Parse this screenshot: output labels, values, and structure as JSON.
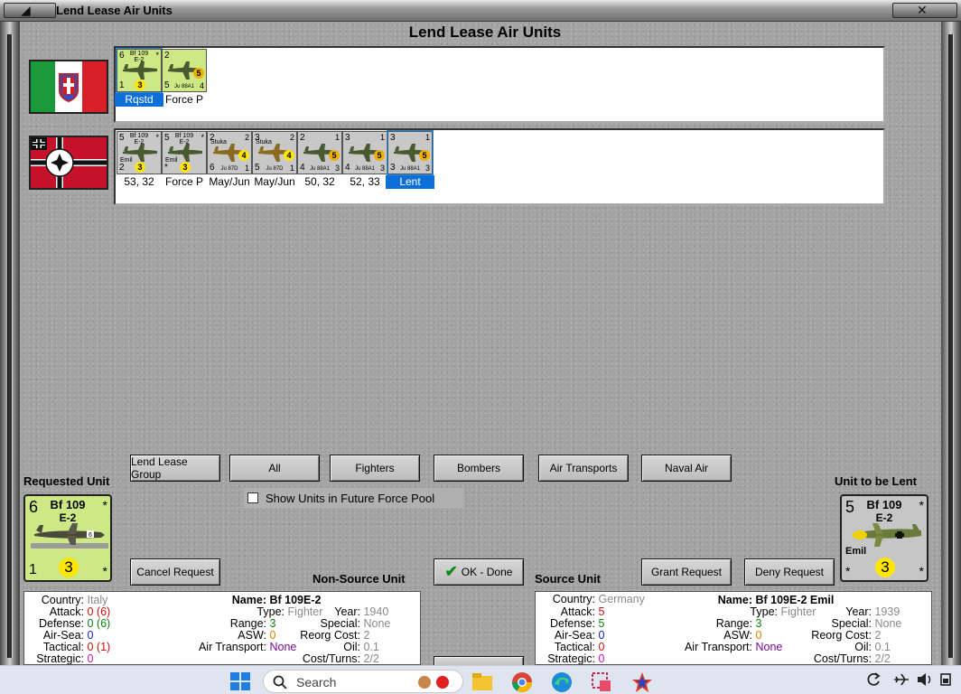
{
  "window": {
    "title": "Lend Lease Air Units"
  },
  "page_title": "Lend Lease Air Units",
  "italy_units": [
    {
      "top_left": "6",
      "name1": "Bf 109",
      "name2": "E-2",
      "star": "*",
      "bottom_left": "1",
      "value": "3",
      "label": "Rqstd",
      "selected": true,
      "bg": "#cde884"
    },
    {
      "top_left": "2",
      "name1": "",
      "name2": "",
      "star": "",
      "bottom_left": "5",
      "bottom_name": "Ju 88A1",
      "bottom_right": "4",
      "value": "5",
      "label": "Force P",
      "selected": false,
      "bg": "#cde884"
    }
  ],
  "germany_units": [
    {
      "top_left": "5",
      "name1": "Bf 109",
      "name2": "E-2",
      "sub": "Emil",
      "star": "*",
      "bottom_left": "2",
      "value": "3",
      "label": "53, 32",
      "bg": "#c8c8c8"
    },
    {
      "top_left": "5",
      "name1": "Bf 109",
      "name2": "E-2",
      "sub": "Emil",
      "star": "*",
      "bottom_left": "*",
      "value": "3",
      "label": "Force P",
      "bg": "#c8c8c8"
    },
    {
      "top_left": "2",
      "name1": "",
      "name2": "",
      "sub": "Stuka",
      "star": "2",
      "bottom_left": "6",
      "bottom_name": "Ju 87D",
      "bottom_right": "1",
      "value": "4",
      "label": "May/Jun",
      "bg": "#c8c8c8"
    },
    {
      "top_left": "3",
      "name1": "",
      "name2": "",
      "sub": "Stuka",
      "star": "2",
      "bottom_left": "5",
      "bottom_name": "Ju 87D",
      "bottom_right": "1",
      "value": "4",
      "label": "May/Jun",
      "bg": "#c8c8c8"
    },
    {
      "top_left": "2",
      "name1": "",
      "name2": "",
      "sub": "",
      "star": "1",
      "bottom_left": "4",
      "bottom_name": "Ju 88A1",
      "bottom_right": "3",
      "value": "5",
      "label": "50, 32",
      "bg": "#c8c8c8"
    },
    {
      "top_left": "3",
      "name1": "",
      "name2": "",
      "sub": "",
      "star": "1",
      "bottom_left": "4",
      "bottom_name": "Ju 88A1",
      "bottom_right": "3",
      "value": "5",
      "label": "52, 33",
      "bg": "#c8c8c8"
    },
    {
      "top_left": "3",
      "name1": "",
      "name2": "",
      "sub": "",
      "star": "1",
      "bottom_left": "3",
      "bottom_name": "Ju 88A1",
      "bottom_right": "3",
      "value": "5",
      "label": "Lent",
      "selected": true,
      "bg": "#c8c8c8"
    }
  ],
  "filter_buttons": {
    "lend_lease_group": "Lend Lease Group",
    "all": "All",
    "fighters": "Fighters",
    "bombers": "Bombers",
    "air_transports": "Air Transports",
    "naval_air": "Naval Air"
  },
  "show_future": "Show Units in Future Force Pool",
  "requested_unit_label": "Requested Unit",
  "unit_to_be_lent_label": "Unit to be Lent",
  "requested_counter": {
    "strength": "6",
    "star": "*",
    "name1": "Bf 109",
    "name2": "E-2",
    "bottom_left": "1",
    "value": "3",
    "bottom_right": "*"
  },
  "lent_counter": {
    "strength": "5",
    "star": "*",
    "name1": "Bf 109",
    "name2": "E-2",
    "sub": "Emil",
    "bottom_left": "*",
    "value": "3",
    "bottom_right": "*"
  },
  "action_buttons": {
    "cancel_request": "Cancel Request",
    "ok_done": "OK - Done",
    "grant_request": "Grant Request",
    "deny_request": "Deny Request"
  },
  "non_source_label": "Non-Source Unit",
  "source_label": "Source Unit",
  "non_source": {
    "country_k": "Country:",
    "country": "Italy",
    "attack_k": "Attack:",
    "attack": "0",
    "attack_x": "(6)",
    "defense_k": "Defense:",
    "defense": "0",
    "defense_x": "(6)",
    "airsea_k": "Air-Sea:",
    "airsea": "0",
    "tactical_k": "Tactical:",
    "tactical": "0",
    "tactical_x": "(1)",
    "strategic_k": "Strategic:",
    "strategic": "0",
    "name_k": "Name:",
    "name": "Bf 109E-2",
    "type_k": "Type:",
    "type": "Fighter",
    "range_k": "Range:",
    "range": "3",
    "asw_k": "ASW:",
    "asw": "0",
    "airtransport_k": "Air Transport:",
    "airtransport": "None",
    "year_k": "Year:",
    "year": "1940",
    "special_k": "Special:",
    "special": "None",
    "reorg_k": "Reorg Cost:",
    "reorg": "2",
    "oil_k": "Oil:",
    "oil": "0.1",
    "cost_k": "Cost/Turns:",
    "cost": "2/2"
  },
  "source": {
    "country_k": "Country:",
    "country": "Germany",
    "attack_k": "Attack:",
    "attack": "5",
    "defense_k": "Defense:",
    "defense": "5",
    "airsea_k": "Air-Sea:",
    "airsea": "0",
    "tactical_k": "Tactical:",
    "tactical": "0",
    "strategic_k": "Strategic:",
    "strategic": "0",
    "name_k": "Name:",
    "name": "Bf 109E-2 Emil",
    "type_k": "Type:",
    "type": "Fighter",
    "range_k": "Range:",
    "range": "3",
    "asw_k": "ASW:",
    "asw": "0",
    "airtransport_k": "Air Transport:",
    "airtransport": "None",
    "year_k": "Year:",
    "year": "1939",
    "special_k": "Special:",
    "special": "None",
    "reorg_k": "Reorg Cost:",
    "reorg": "2",
    "oil_k": "Oil:",
    "oil": "0.1",
    "cost_k": "Cost/Turns:",
    "cost": "2/2"
  },
  "taskbar": {
    "search_placeholder": "Search"
  }
}
